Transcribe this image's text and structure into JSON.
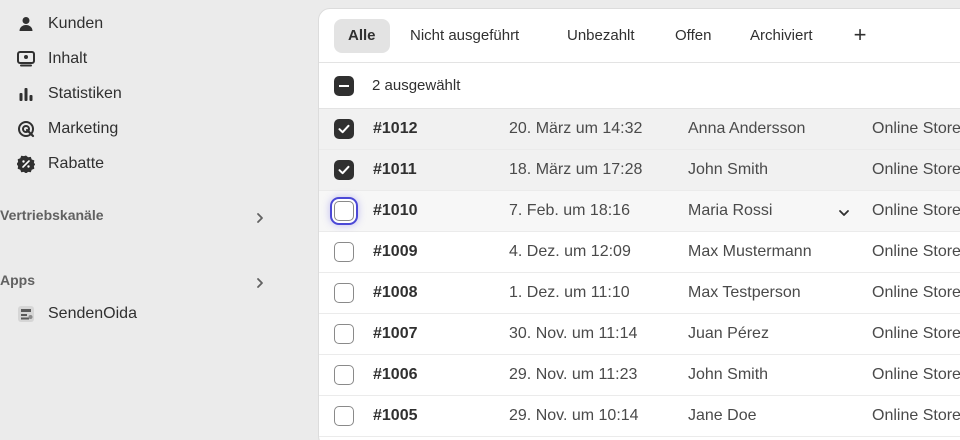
{
  "sidebar": {
    "items": [
      {
        "label": "Kunden",
        "icon": "person-icon"
      },
      {
        "label": "Inhalt",
        "icon": "image-icon"
      },
      {
        "label": "Statistiken",
        "icon": "bar-chart-icon"
      },
      {
        "label": "Marketing",
        "icon": "target-icon"
      },
      {
        "label": "Rabatte",
        "icon": "discount-icon"
      }
    ],
    "sales_channels_title": "Vertriebskanäle",
    "apps_title": "Apps",
    "apps": [
      {
        "label": "SendenOida",
        "icon": "app-icon"
      }
    ]
  },
  "tabs": [
    {
      "label": "Alle",
      "active": true
    },
    {
      "label": "Nicht ausgeführt"
    },
    {
      "label": "Unbezahlt"
    },
    {
      "label": "Offen"
    },
    {
      "label": "Archiviert"
    }
  ],
  "add_tab_label": "+",
  "bulk": {
    "selected_text": "2 ausgewählt"
  },
  "orders": [
    {
      "order": "#1012",
      "date": "20. März um 14:32",
      "customer": "Anna Andersson",
      "channel": "Online Store",
      "checked": true
    },
    {
      "order": "#1011",
      "date": "18. März um 17:28",
      "customer": "John Smith",
      "channel": "Online Store",
      "checked": true
    },
    {
      "order": "#1010",
      "date": "7. Feb. um 18:16",
      "customer": "Maria Rossi",
      "channel": "Online Store",
      "checked": false,
      "focused": true
    },
    {
      "order": "#1009",
      "date": "4. Dez. um 12:09",
      "customer": "Max Mustermann",
      "channel": "Online Store",
      "checked": false
    },
    {
      "order": "#1008",
      "date": "1. Dez. um 11:10",
      "customer": "Max Testperson",
      "channel": "Online Store",
      "checked": false
    },
    {
      "order": "#1007",
      "date": "30. Nov. um 11:14",
      "customer": "Juan Pérez",
      "channel": "Online Store",
      "checked": false
    },
    {
      "order": "#1006",
      "date": "29. Nov. um 11:23",
      "customer": "John Smith",
      "channel": "Online Store",
      "checked": false
    },
    {
      "order": "#1005",
      "date": "29. Nov. um 10:14",
      "customer": "Jane Doe",
      "channel": "Online Store",
      "checked": false
    }
  ],
  "colors": {
    "accent_focus": "#4b48d6",
    "checkbox_checked": "#303030"
  }
}
